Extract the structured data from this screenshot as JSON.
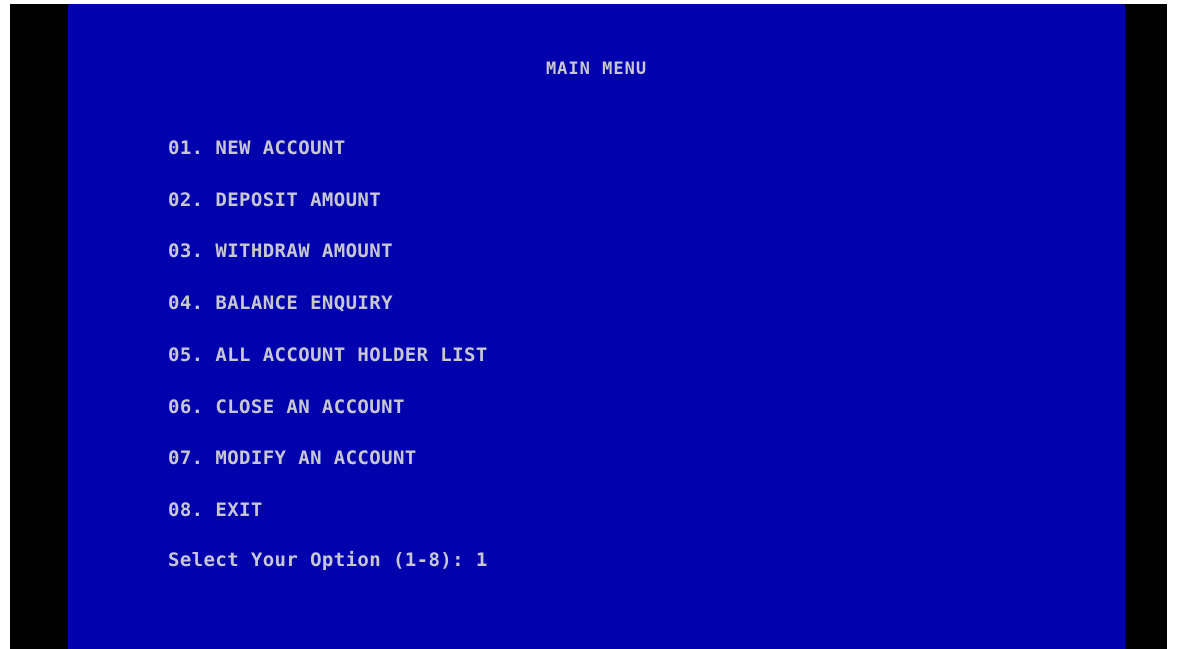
{
  "screen": {
    "title": "MAIN MENU",
    "menu": [
      {
        "label": "01. NEW ACCOUNT"
      },
      {
        "label": "02. DEPOSIT AMOUNT"
      },
      {
        "label": "03. WITHDRAW AMOUNT"
      },
      {
        "label": "04. BALANCE ENQUIRY"
      },
      {
        "label": "05. ALL ACCOUNT HOLDER LIST"
      },
      {
        "label": "06. CLOSE AN ACCOUNT"
      },
      {
        "label": "07. MODIFY AN ACCOUNT"
      },
      {
        "label": "08. EXIT"
      }
    ],
    "prompt": "Select Your Option (1-8): ",
    "input_value": "1"
  },
  "colors": {
    "background": "#0303ad",
    "text": "#c7c7d3",
    "border": "#000000"
  }
}
